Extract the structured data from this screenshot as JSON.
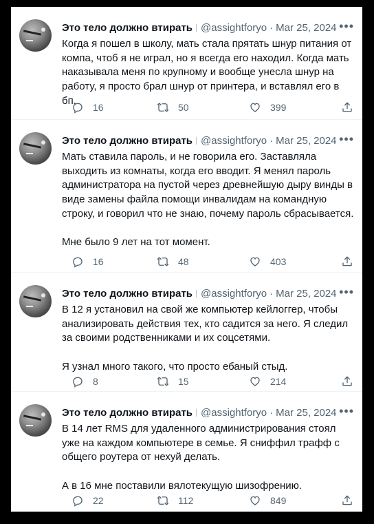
{
  "tweets": [
    {
      "name": "Это тело должно втирать",
      "handle": "@assightforyo",
      "date": "Mar 25, 2024",
      "text": "Когда я пошел в школу, мать стала прятать шнур питания от компа, чтоб я не играл, но я всегда его находил. Когда мать наказывала меня по крупному и вообще унесла шнур на работу, я просто брал шнур от принтера, и вставлял его в бп.",
      "replies": "16",
      "retweets": "50",
      "likes": "399"
    },
    {
      "name": "Это тело должно втирать",
      "handle": "@assightforyo",
      "date": "Mar 25, 2024",
      "text": "Мать ставила пароль, и не говорила его. Заставляла выходить из комнаты, когда его вводит. Я менял пароль администратора на пустой через древнейшую дыру винды в виде замены файла помощи инвалидам на командную строку, и говорил что не знаю, почему пароль сбрасывается.\n\nМне было 9 лет на тот момент.",
      "replies": "16",
      "retweets": "48",
      "likes": "403"
    },
    {
      "name": "Это тело должно втирать",
      "handle": "@assightforyo",
      "date": "Mar 25, 2024",
      "text": "В 12 я установил на свой же компьютер кейлоггер, чтобы анализировать действия тех, кто садится за него. Я следил за своими родственниками и их соцсетями.\n\nЯ узнал много такого, что просто ебаный стыд.",
      "replies": "8",
      "retweets": "15",
      "likes": "214"
    },
    {
      "name": "Это тело должно втирать",
      "handle": "@assightforyo",
      "date": "Mar 25, 2024",
      "text": "В 14 лет RMS для удаленного администрирования стоял уже на каждом компьютере в семье. Я сниффил трафф с общего роутера от нехуй делать.\n\nА в 16 мне поставили вялотекущую шизофрению.",
      "replies": "22",
      "retweets": "112",
      "likes": "849"
    }
  ],
  "icons": {
    "reply": "reply-icon",
    "retweet": "retweet-icon",
    "like": "heart-icon",
    "share": "share-icon",
    "more": "more-icon"
  }
}
